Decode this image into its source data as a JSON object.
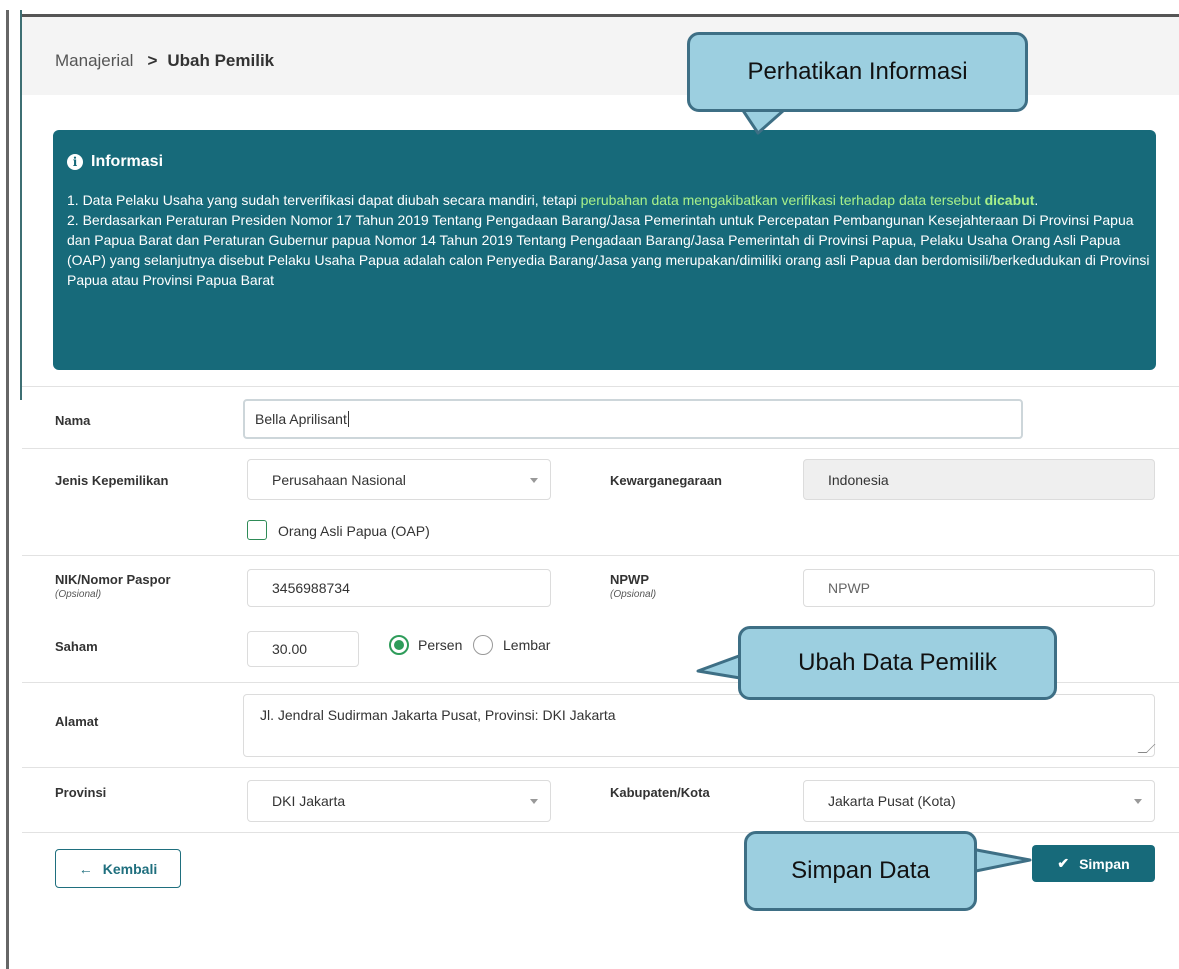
{
  "breadcrumb": {
    "parent": "Manajerial",
    "separator": ">",
    "current": "Ubah Pemilik"
  },
  "info": {
    "title": "Informasi",
    "icon": "info-circle-icon",
    "item1_pre": "1. Data Pelaku Usaha yang sudah terverifikasi dapat diubah secara mandiri, tetapi ",
    "item1_highlight": "perubahan data mengakibatkan verifikasi terhadap data tersebut",
    "item1_bold": "dicabut",
    "item1_end": ".",
    "item2": "2. Berdasarkan Peraturan Presiden Nomor 17 Tahun 2019 Tentang Pengadaan Barang/Jasa Pemerintah untuk Percepatan Pembangunan Kesejahteraan Di Provinsi Papua dan Papua Barat dan Peraturan Gubernur papua Nomor 14 Tahun 2019 Tentang Pengadaan Barang/Jasa Pemerintah di Provinsi Papua, Pelaku Usaha Orang Asli Papua (OAP) yang selanjutnya disebut Pelaku Usaha Papua adalah calon Penyedia Barang/Jasa yang merupakan/dimiliki orang asli Papua dan berdomisili/berkedudukan di Provinsi Papua atau Provinsi Papua Barat"
  },
  "form": {
    "nama": {
      "label": "Nama",
      "value": "Bella Aprilisant"
    },
    "jenis": {
      "label": "Jenis Kepemilikan",
      "value": "Perusahaan Nasional"
    },
    "kewarganegaraan": {
      "label": "Kewarganegaraan",
      "value": "Indonesia"
    },
    "oap": {
      "label": "Orang Asli Papua (OAP)",
      "checked": false
    },
    "nik": {
      "label": "NIK/Nomor Paspor",
      "sub": "(Opsional)",
      "value": "3456988734"
    },
    "npwp": {
      "label": "NPWP",
      "sub": "(Opsional)",
      "placeholder": "NPWP"
    },
    "saham": {
      "label": "Saham",
      "value": "30.00",
      "option1": "Persen",
      "option2": "Lembar",
      "selected": "Persen"
    },
    "alamat": {
      "label": "Alamat",
      "value": "Jl. Jendral Sudirman Jakarta Pusat, Provinsi: DKI Jakarta"
    },
    "provinsi": {
      "label": "Provinsi",
      "value": "DKI Jakarta"
    },
    "kabupaten": {
      "label": "Kabupaten/Kota",
      "value": "Jakarta Pusat (Kota)"
    }
  },
  "buttons": {
    "back": "Kembali",
    "back_icon": "arrow-left-icon",
    "save": "Simpan",
    "save_icon": "check-icon"
  },
  "callouts": {
    "info": "Perhatikan Informasi",
    "edit": "Ubah Data Pemilik",
    "save": "Simpan Data"
  },
  "colors": {
    "primary": "#176a7a",
    "highlight": "#a8f08a",
    "callout_fill": "#9ccfe0",
    "callout_border": "#3e6f85",
    "radio_on": "#2e9c5a"
  }
}
